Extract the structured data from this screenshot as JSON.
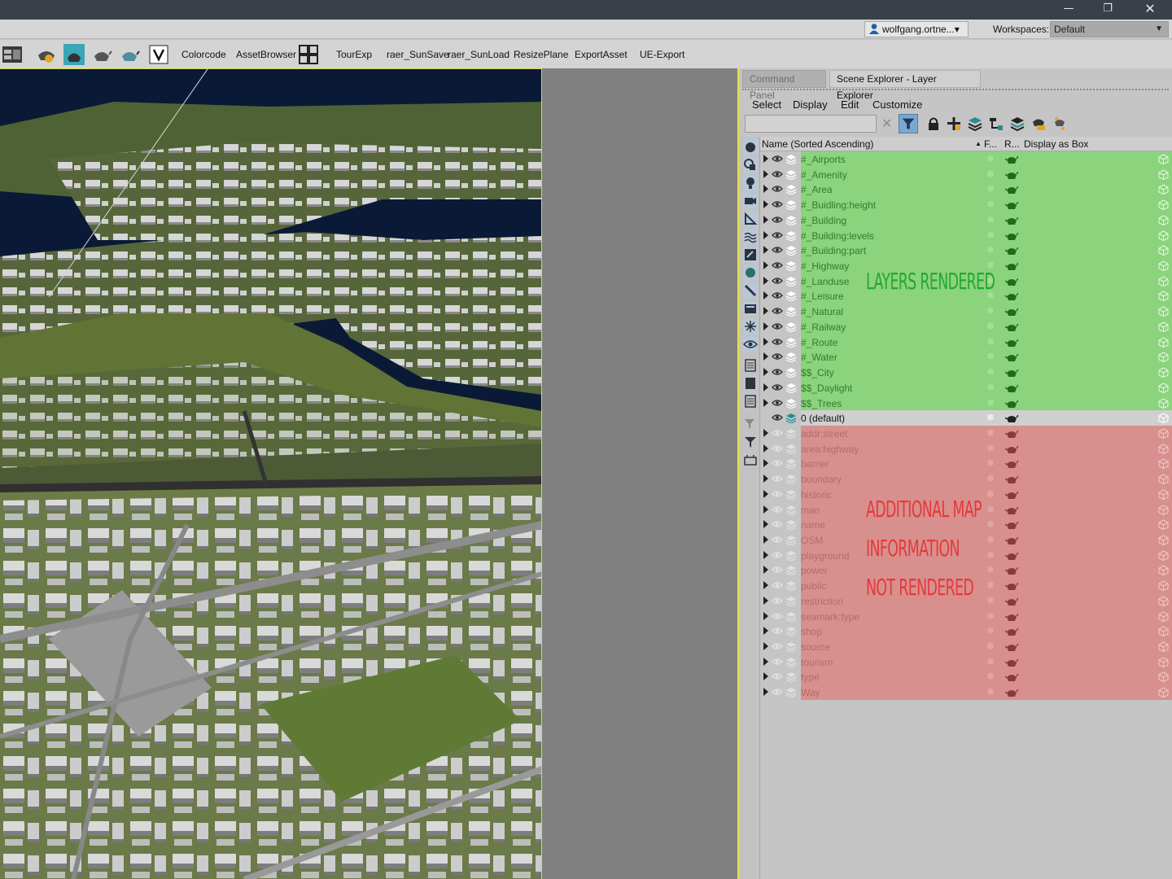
{
  "window": {
    "minimize_glyph": "—",
    "restore_glyph": "❐",
    "close_glyph": "✕"
  },
  "userbar": {
    "user_name": "wolfgang.ortne...",
    "user_dropdown_glyph": "▾",
    "workspaces_label": "Workspaces:",
    "workspace_value": "Default",
    "workspace_arrow": "▼"
  },
  "toolbar": {
    "items": [
      "Colorcode",
      "AssetBrowser",
      "TourExp",
      "raer_SunSave",
      "raer_SunLoad",
      "ResizePlane",
      "ExportAsset",
      "UE-Export"
    ],
    "icons": [
      "render-setup-icon",
      "sun-settings-icon",
      "teapot-render-icon",
      "teapot-active-icon",
      "teapot-iterative-icon",
      "filter-v-icon",
      "asset-grid-icon"
    ]
  },
  "panel": {
    "tabs": [
      "Command Panel",
      "Scene Explorer - Layer Explorer"
    ],
    "menu": [
      "Select",
      "Display",
      "Edit",
      "Customize"
    ],
    "search": {
      "value": "",
      "clear_glyph": "✕"
    },
    "columns": {
      "name": "Name (Sorted Ascending)",
      "sort_glyph": "▲",
      "frozen": "F...",
      "render": "R...",
      "display_box": "Display as Box"
    },
    "freeze_glyph": "❄",
    "rendered_layers": [
      "#_Airports",
      "#_Amenity",
      "#_Area",
      "#_Buidling:height",
      "#_Building",
      "#_Building:levels",
      "#_Building:part",
      "#_Highway",
      "#_Landuse",
      "#_Leisure",
      "#_Natural",
      "#_Railway",
      "#_Route",
      "#_Water",
      "$$_City",
      "$$_Daylight",
      "$$_Trees"
    ],
    "default_layer": "0 (default)",
    "hidden_layers": [
      "addr:street",
      "area:highway",
      "barrier",
      "boundary",
      "historic",
      "man",
      "name",
      "OSM",
      "playground",
      "power",
      "public",
      "restriction",
      "seamark:type",
      "shop",
      "source",
      "tourism",
      "type",
      "Way"
    ]
  },
  "annotations": {
    "green_note": "LAYERS RENDERED",
    "red_note_lines": [
      "ADDITIONAL MAP",
      "INFORMATION",
      "NOT RENDERED"
    ]
  },
  "colors": {
    "rendered_band": "#8bd37d",
    "hidden_band": "#d7908e",
    "green_note": "#22a830",
    "red_note": "#e6383a",
    "viewport_border": "#e6e04a"
  }
}
